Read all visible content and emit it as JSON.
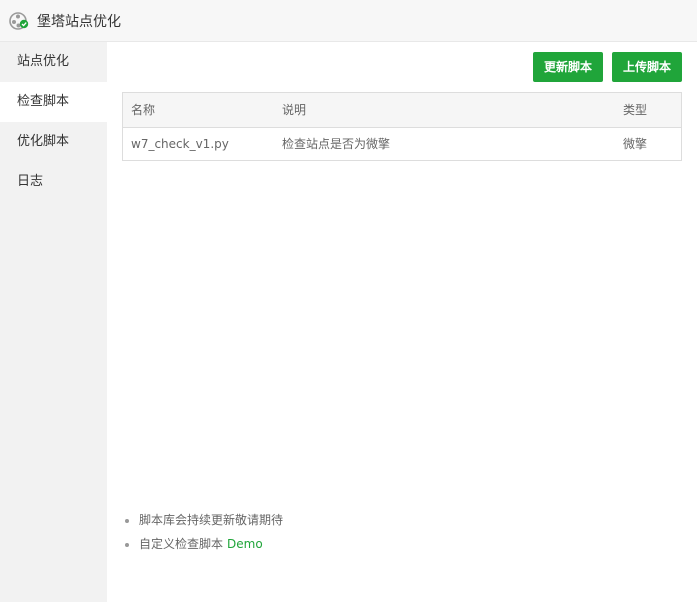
{
  "app": {
    "title": "堡塔站点优化",
    "icon": "bt-site-optimize-icon"
  },
  "sidebar": {
    "items": [
      {
        "label": "站点优化",
        "active": false
      },
      {
        "label": "检查脚本",
        "active": true
      },
      {
        "label": "优化脚本",
        "active": false
      },
      {
        "label": "日志",
        "active": false
      }
    ]
  },
  "toolbar": {
    "update_label": "更新脚本",
    "upload_label": "上传脚本"
  },
  "table": {
    "headers": {
      "name": "名称",
      "desc": "说明",
      "type": "类型"
    },
    "rows": [
      {
        "name": "w7_check_v1.py",
        "desc": "检查站点是否为微擎",
        "type": "微擎"
      }
    ]
  },
  "notes": {
    "item1": "脚本库会持续更新敬请期待",
    "item2_prefix": "自定义检查脚本",
    "item2_link": "Demo"
  },
  "colors": {
    "accent": "#20a53a",
    "sidebar_bg": "#f2f2f2",
    "titlebar_bg": "#f7f7f7"
  }
}
